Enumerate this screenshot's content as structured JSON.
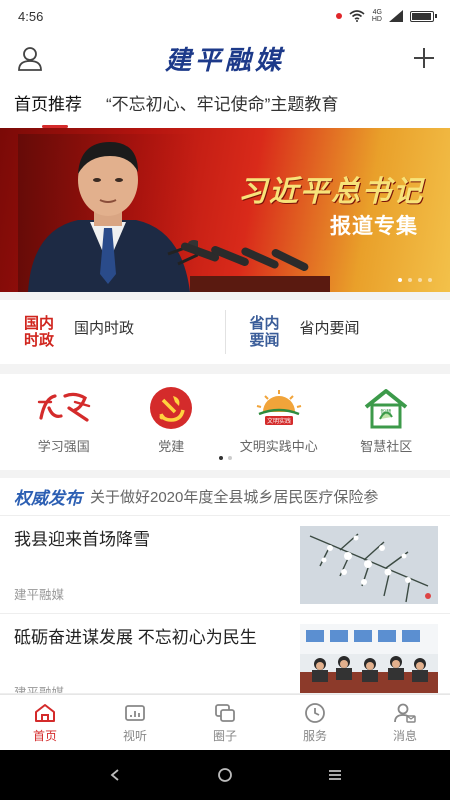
{
  "status_bar": {
    "time": "4:56",
    "network": "4G",
    "network_sub": "HD"
  },
  "header": {
    "title": "建平融媒"
  },
  "tabs": [
    {
      "label": "首页推荐",
      "active": true
    },
    {
      "label": "“不忘初心、牢记使命”主题教育",
      "active": false
    }
  ],
  "banner": {
    "title": "习近平总书记",
    "subtitle": "报道专集",
    "slide_count": 4,
    "active_slide": 0
  },
  "categories": [
    {
      "badge": "国内\n时政",
      "badge_line1": "国内",
      "badge_line2": "时政",
      "label": "国内时政",
      "color": "#d0251e"
    },
    {
      "badge_line1": "省内",
      "badge_line2": "要闻",
      "label": "省内要闻",
      "color": "#3b5d99"
    }
  ],
  "services": [
    {
      "label": "学习强国",
      "icon": "xuexi-logo-icon"
    },
    {
      "label": "党建",
      "icon": "party-emblem-icon"
    },
    {
      "label": "文明实践中心",
      "icon": "civilization-sun-icon",
      "icon_text": "文明实践"
    },
    {
      "label": "智慧社区",
      "icon": "smart-community-house-icon",
      "icon_text": "智慧\n社区"
    }
  ],
  "service_pages": {
    "count": 2,
    "active": 0
  },
  "ticker": {
    "label": "权威发布",
    "text": "关于做好2020年度全县城乡居民医疗保险参"
  },
  "news": [
    {
      "title": "我县迎来首场降雪",
      "source": "建平融媒",
      "thumb": "snowy-pine-photo"
    },
    {
      "title": "砥砺奋进谋发展 不忘初心为民生",
      "source": "建平融媒",
      "thumb": "meeting-room-photo"
    }
  ],
  "bottom_nav": [
    {
      "label": "首页",
      "icon": "home-icon",
      "active": true
    },
    {
      "label": "视听",
      "icon": "video-icon",
      "active": false
    },
    {
      "label": "圈子",
      "icon": "circle-icon",
      "active": false
    },
    {
      "label": "服务",
      "icon": "clock-icon",
      "active": false
    },
    {
      "label": "消息",
      "icon": "message-user-icon",
      "active": false
    }
  ],
  "colors": {
    "accent": "#d42b2b",
    "brand_blue": "#1d3a8a",
    "category_red": "#d0251e",
    "category_blue": "#3b5d99"
  }
}
